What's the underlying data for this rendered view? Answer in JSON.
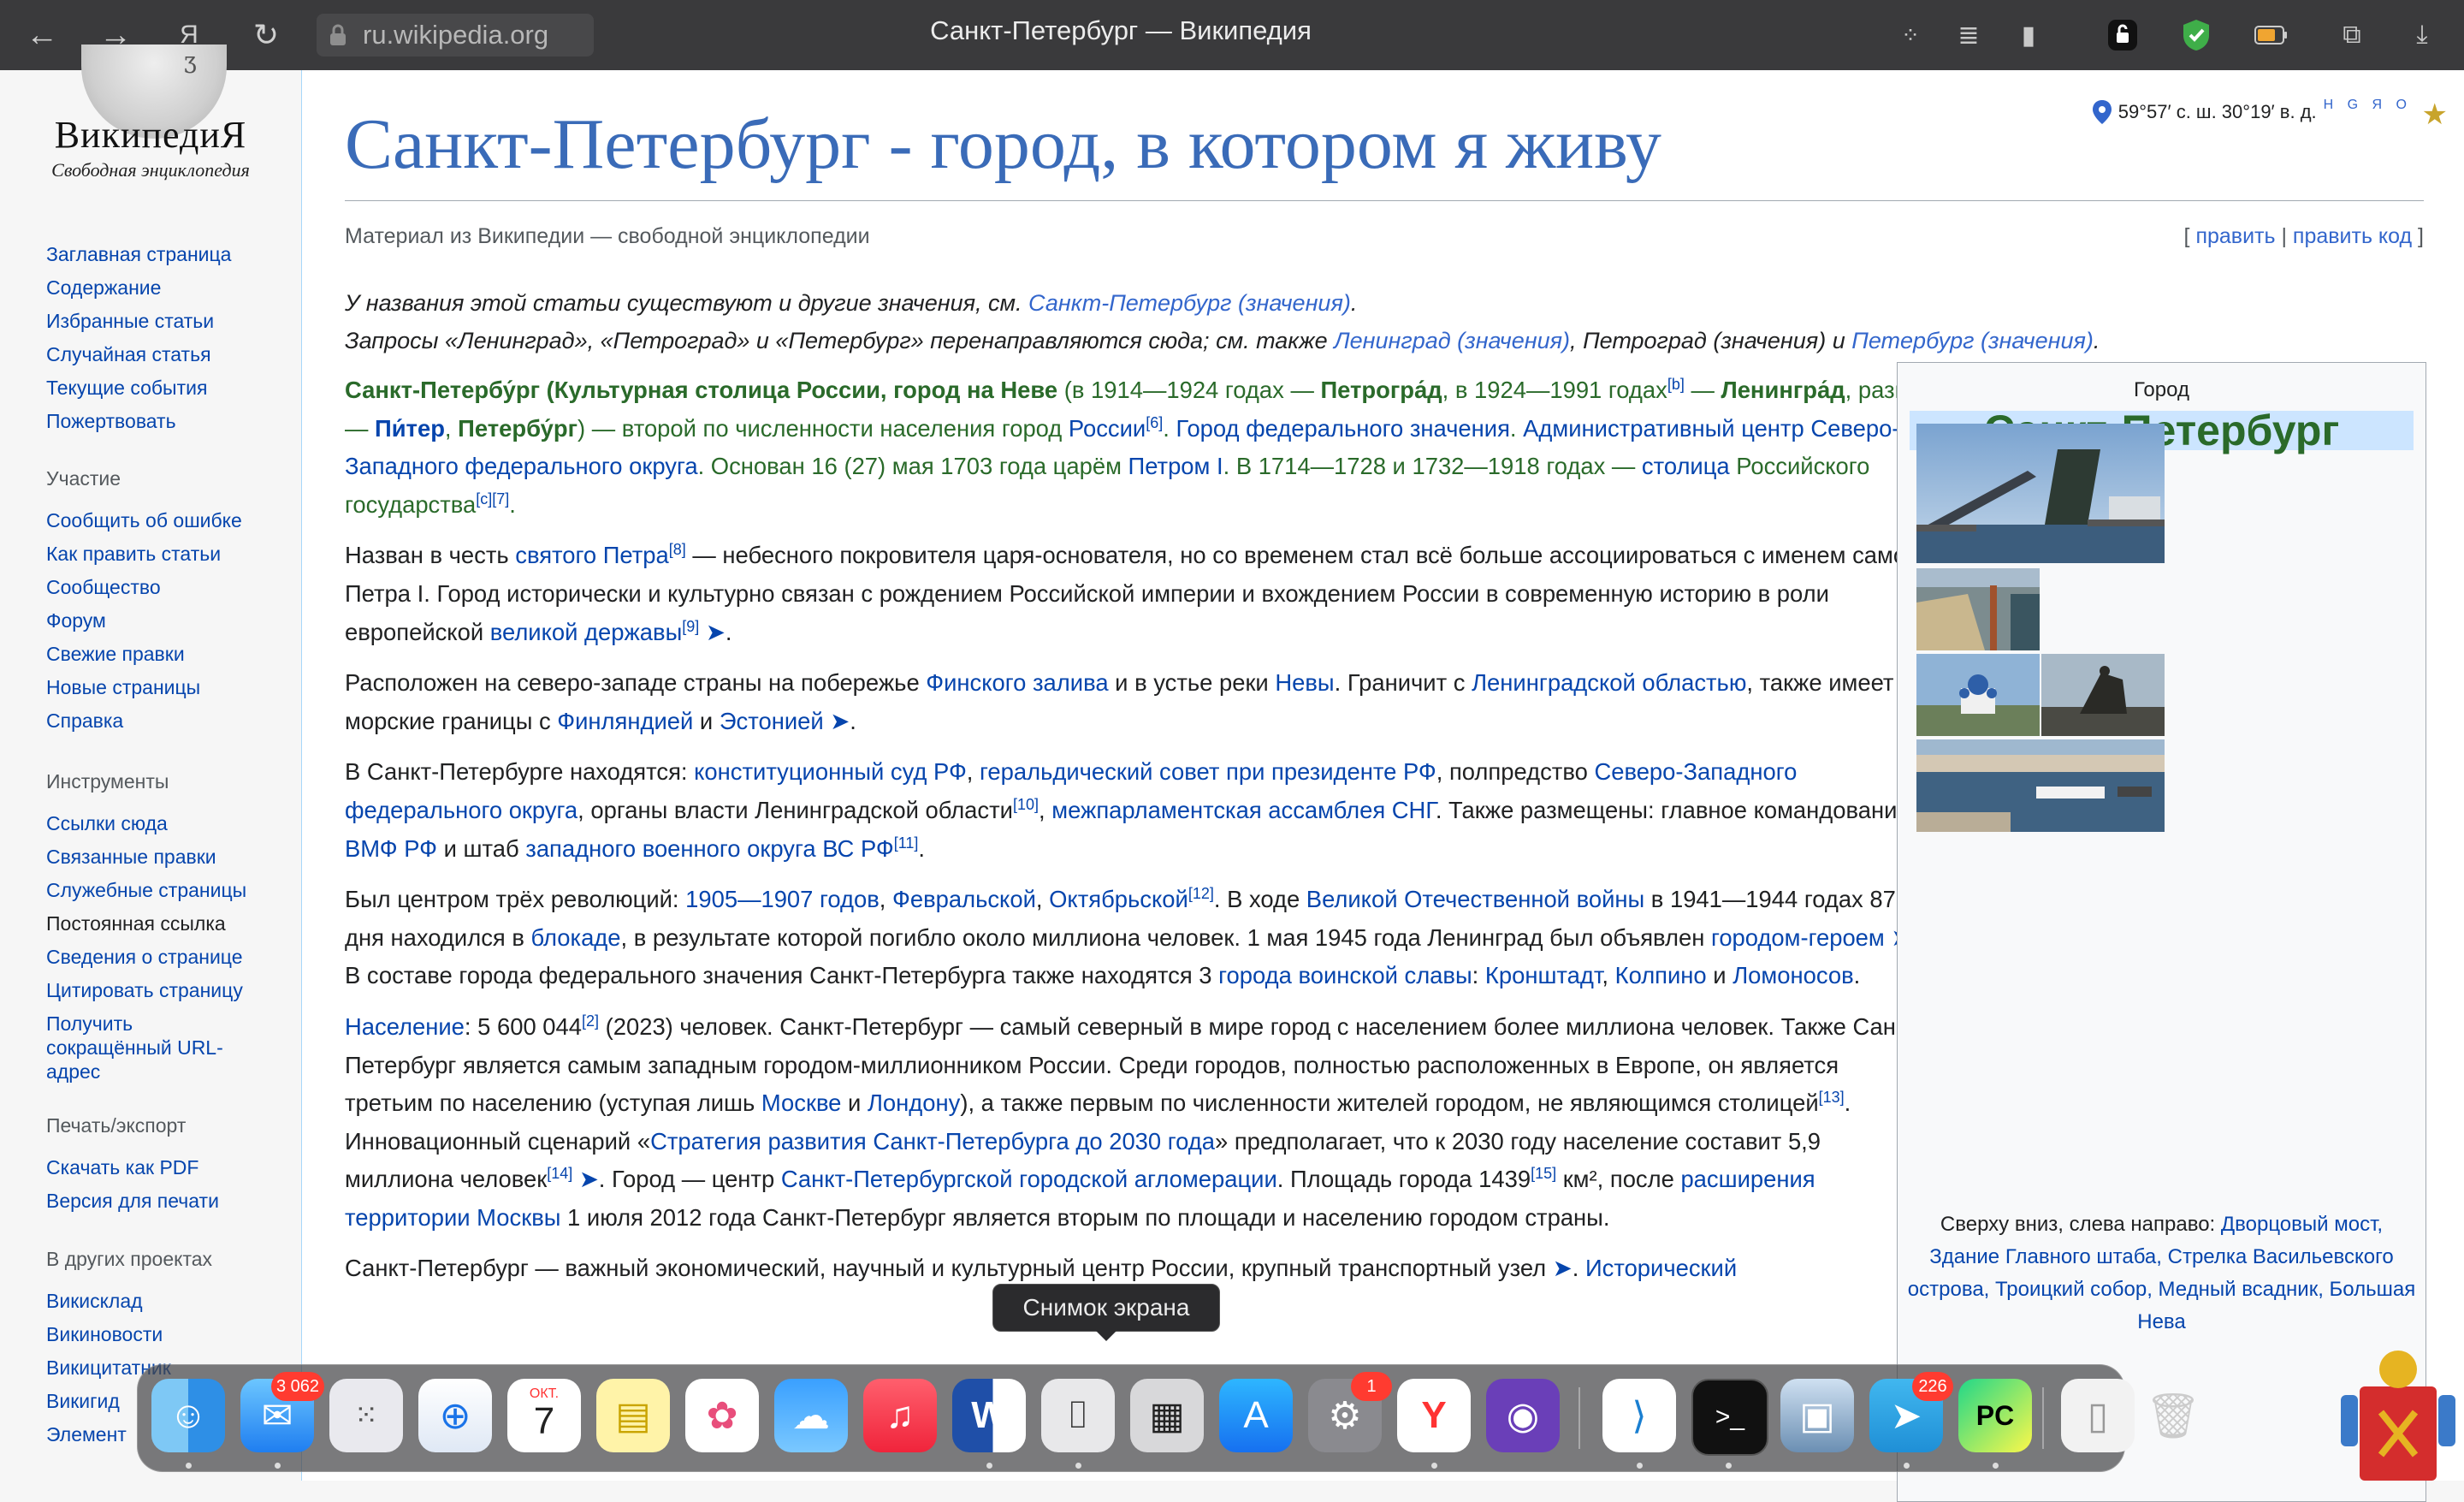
{
  "browser": {
    "url": "ru.wikipedia.org",
    "title": "Санкт-Петербург — Википедия"
  },
  "logo": {
    "name": "ВикипедиЯ",
    "tagline": "Свободная энциклопедия",
    "globe_glyph": "Ʒ"
  },
  "sidebar": {
    "nav": [
      "Заглавная страница",
      "Содержание",
      "Избранные статьи",
      "Случайная статья",
      "Текущие события",
      "Пожертвовать"
    ],
    "participation": {
      "heading": "Участие",
      "items": [
        "Сообщить об ошибке",
        "Как править статьи",
        "Сообщество",
        "Форум",
        "Свежие правки",
        "Новые страницы",
        "Справка"
      ]
    },
    "tools": {
      "heading": "Инструменты",
      "items": [
        "Ссылки сюда",
        "Связанные правки",
        "Служебные страницы",
        "Постоянная ссылка",
        "Сведения о странице",
        "Цитировать страницу"
      ],
      "shorturl": "Получить сокращённый URL-адрес"
    },
    "print": {
      "heading": "Печать/экспорт",
      "items": [
        "Скачать как PDF",
        "Версия для печати"
      ]
    },
    "other": {
      "heading": "В других проектах",
      "items": [
        "Викисклад",
        "Викиновости",
        "Викицитатник",
        "Викигид",
        "Элемент"
      ]
    }
  },
  "article": {
    "coords": "59°57′ с. ш. 30°19′ в. д.",
    "coords_sup": "H G Я O",
    "title": "Санкт-Петербург - город, в котором я живу",
    "tagline": "Материал из Википедии — свободной энциклопедии",
    "edit": {
      "open": "[ ",
      "edit": "править",
      "sep": " | ",
      "editcode": "править код",
      "close": " ]"
    },
    "hatnote1": {
      "pre": "У названия этой статьи существуют и другие значения, см. ",
      "link": "Санкт-Петербург (значения)",
      "post": "."
    },
    "hatnote2": {
      "pre": "Запросы «Ленинград», «Петроград» и «Петербург» перенаправляются сюда; см. также ",
      "l1": "Ленинград (значения)",
      "s1": ", ",
      "l2": "Петроград (значения)",
      "s2": " и ",
      "l3": "Петербург (значения)",
      "post": "."
    }
  },
  "infobox": {
    "type": "Город",
    "name": "Санкт-Петербург",
    "caption_pre": "Сверху вниз, слева направо: ",
    "caption_links": "Дворцовый мост, Здание Главного штаба, Стрелка Васильевского острова, Троицкий собор, Медный всадник, Большая Нева"
  },
  "dock": {
    "tooltip": "Снимок экрана",
    "mail_badge": "3 062",
    "calendar_month": "ОКТ.",
    "calendar_day": "7",
    "settings_badge": "1",
    "telegram_badge": "226",
    "terminal_glyph": ">_",
    "pycharm_glyph": "PC"
  }
}
